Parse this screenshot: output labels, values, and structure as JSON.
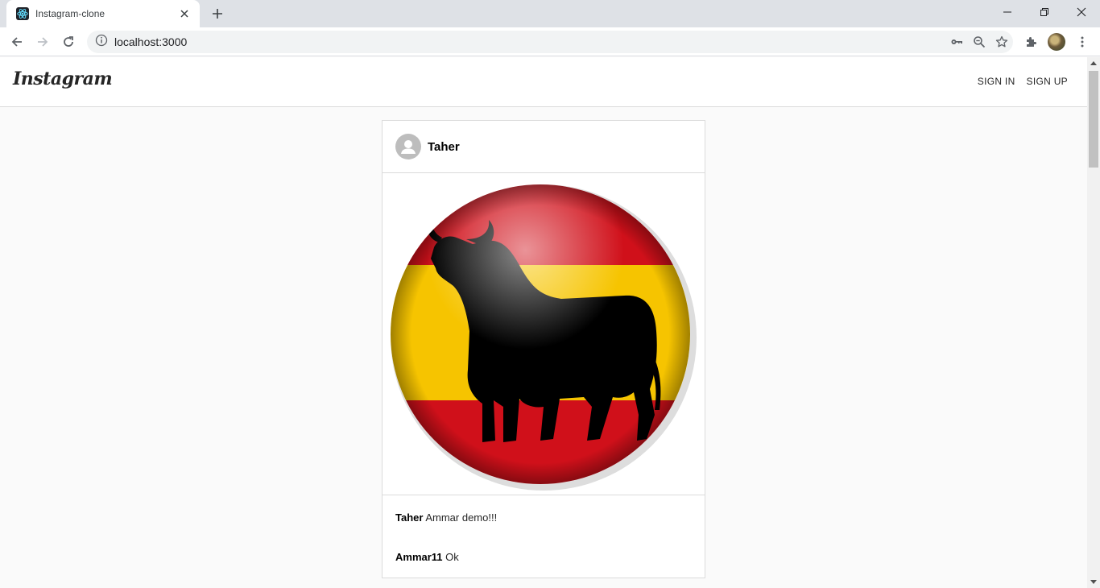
{
  "browser": {
    "tab_title": "Instagram-clone",
    "url": "localhost:3000",
    "icons": [
      "react-favicon",
      "close-icon",
      "plus-icon",
      "minimize-icon",
      "restore-icon",
      "close-window-icon",
      "back-icon",
      "forward-icon",
      "reload-icon",
      "info-icon",
      "key-icon",
      "zoom-icon",
      "star-icon",
      "extensions-icon",
      "profile-avatar",
      "menu-icon"
    ]
  },
  "app": {
    "brand": "Instagram",
    "nav_links": [
      "SIGN IN",
      "SIGN UP"
    ]
  },
  "post": {
    "username": "Taher",
    "caption_user": "Taher",
    "caption_text": "Ammar demo!!!",
    "comments": [
      {
        "user": "Ammar11",
        "text": "Ok"
      }
    ],
    "image": "spanish-flag-bull-badge"
  },
  "colors": {
    "flag_red": "#d0101a",
    "flag_yellow": "#f6c400",
    "page_bg": "#fafafa",
    "border": "#dbdbdb"
  }
}
